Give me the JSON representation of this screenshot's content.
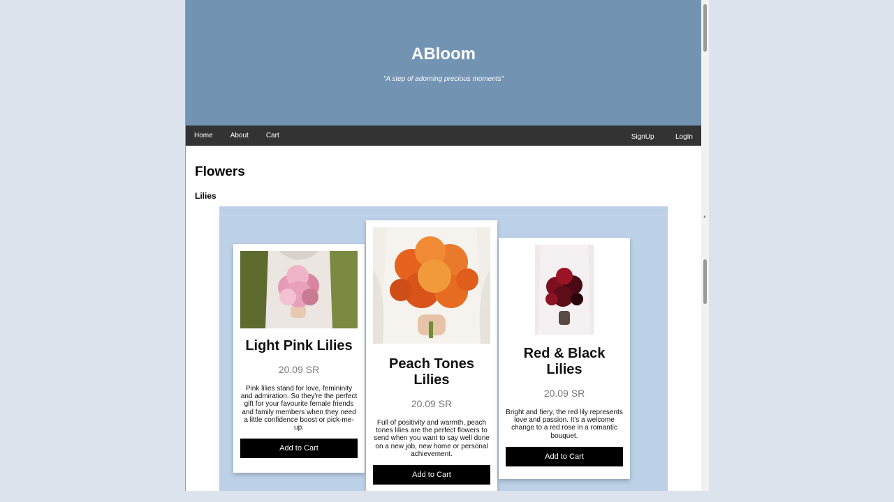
{
  "header": {
    "brand": "ABloom",
    "tagline": "\"A step of adorning precious moments\""
  },
  "nav": {
    "left": [
      "Home",
      "About",
      "Cart"
    ],
    "right": [
      "SignUp",
      "LogIn"
    ]
  },
  "main": {
    "heading": "Flowers",
    "subheading": "Lilies"
  },
  "products": [
    {
      "title": "Light Pink Lilies",
      "price": "20.09 SR",
      "description": "Pink lilies stand for love, femininity and admiration. So they're the perfect gift for your favourite female friends and family members when they need a little confidence boost or pick-me-up.",
      "button": "Add to Cart"
    },
    {
      "title": "Peach Tones Lilies",
      "price": "20.09 SR",
      "description": "Full of positivity and warmth, peach tones lilies are the perfect flowers to send when you want to say well done on a new job, new home or personal achievement.",
      "button": "Add to Cart"
    },
    {
      "title": "Red & Black Lilies",
      "price": "20.09 SR",
      "description": "Bright and fiery, the red lily represents love and passion. It's a welcome change to a red rose in a romantic bouquet.",
      "button": "Add to Cart"
    }
  ],
  "colors": {
    "hero": "#7393b3",
    "nav": "#333333",
    "gallery": "#bcd0e7",
    "button": "#000000"
  }
}
